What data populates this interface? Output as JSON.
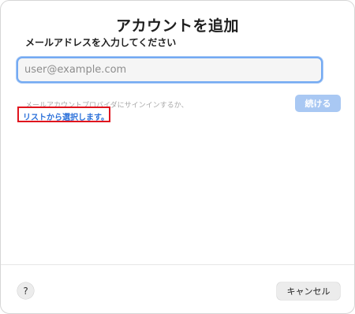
{
  "dialog": {
    "title": "アカウントを追加",
    "subtitle": "メールアドレスを入力してください",
    "email_input": {
      "value": "",
      "placeholder": "user@example.com"
    },
    "hint": "メールアカウントプロバイダにサインインするか、",
    "list_link": "リストから選択します。",
    "continue_label": "続ける",
    "help_label": "?",
    "cancel_label": "キャンセル"
  },
  "colors": {
    "focus_ring": "#74aaf2",
    "link": "#2a6fd9",
    "continue_disabled": "#a9c8f3",
    "highlight_box": "#e0141e"
  }
}
